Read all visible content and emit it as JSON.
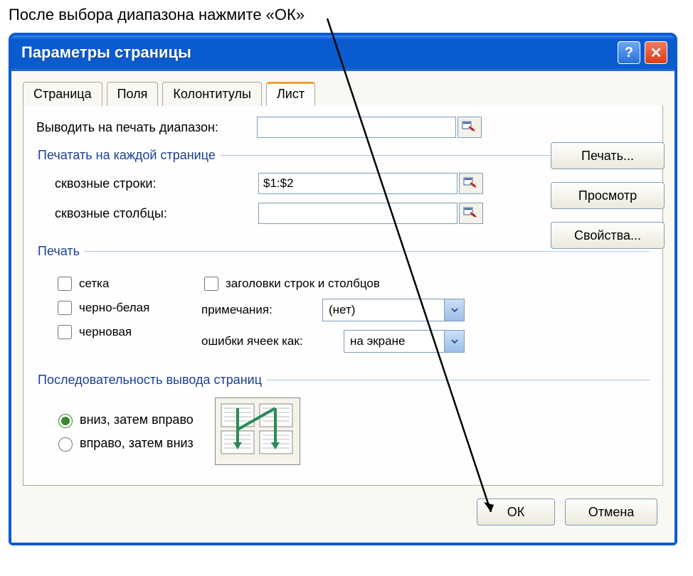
{
  "annotation": "После выбора диапазона нажмите «ОК»",
  "window": {
    "title": "Параметры страницы"
  },
  "tabs": {
    "page": "Страница",
    "margins": "Поля",
    "headers": "Колонтитулы",
    "sheet": "Лист"
  },
  "sheet": {
    "print_range_label": "Выводить на печать диапазон:",
    "print_range_value": "",
    "repeat_legend": "Печатать на каждой странице",
    "rows_label": "сквозные строки:",
    "rows_value": "$1:$2",
    "cols_label": "сквозные столбцы:",
    "cols_value": ""
  },
  "print": {
    "legend": "Печать",
    "grid": "сетка",
    "bw": "черно-белая",
    "draft": "черновая",
    "headings": "заголовки строк и столбцов",
    "notes_label": "примечания:",
    "notes_value": "(нет)",
    "errors_label": "ошибки ячеек как:",
    "errors_value": "на экране"
  },
  "order": {
    "legend": "Последовательность вывода страниц",
    "down_then_over": "вниз, затем вправо",
    "over_then_down": "вправо, затем вниз"
  },
  "side_buttons": {
    "print": "Печать...",
    "preview": "Просмотр",
    "options": "Свойства..."
  },
  "footer": {
    "ok": "ОК",
    "cancel": "Отмена"
  }
}
